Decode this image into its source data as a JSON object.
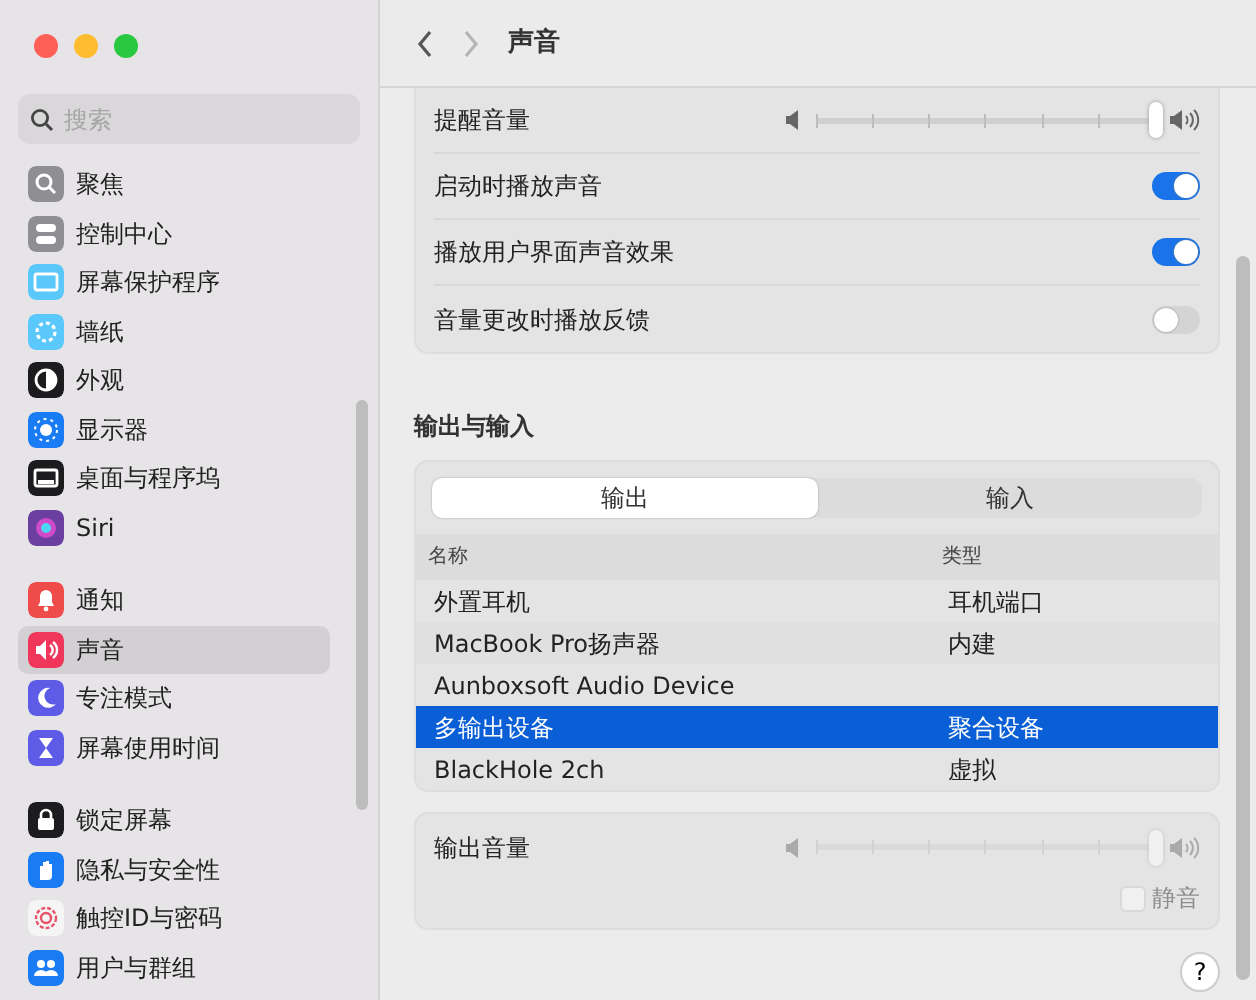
{
  "sidebar": {
    "search": {
      "placeholder": "搜索"
    },
    "groups": [
      {
        "items": [
          {
            "label": "聚焦",
            "color": "#8e8e93",
            "selected": false
          },
          {
            "label": "控制中心",
            "color": "#8e8e93",
            "selected": false
          },
          {
            "label": "屏幕保护程序",
            "color": "#5ac8fa",
            "selected": false
          },
          {
            "label": "墙纸",
            "color": "#5ac8fa",
            "selected": false
          },
          {
            "label": "外观",
            "color": "#1c1c1e",
            "selected": false
          },
          {
            "label": "显示器",
            "color": "#1a7cf5",
            "selected": false
          },
          {
            "label": "桌面与程序坞",
            "color": "#1c1c1e",
            "selected": false
          },
          {
            "label": "Siri",
            "color": "#6b3fa0",
            "selected": false
          }
        ]
      },
      {
        "items": [
          {
            "label": "通知",
            "color": "#f04b4b",
            "selected": false
          },
          {
            "label": "声音",
            "color": "#f0365a",
            "selected": true
          },
          {
            "label": "专注模式",
            "color": "#5e5ce6",
            "selected": false
          },
          {
            "label": "屏幕使用时间",
            "color": "#5e5ce6",
            "selected": false
          }
        ]
      },
      {
        "items": [
          {
            "label": "锁定屏幕",
            "color": "#1c1c1e",
            "selected": false
          },
          {
            "label": "隐私与安全性",
            "color": "#1a7cf5",
            "selected": false
          },
          {
            "label": "触控ID与密码",
            "color": "#f5f5f5",
            "selected": false
          },
          {
            "label": "用户与群组",
            "color": "#1a7cf5",
            "selected": false
          }
        ]
      }
    ]
  },
  "toolbar": {
    "title": "声音"
  },
  "settings": [
    {
      "kind": "slider",
      "label": "提醒音量",
      "level": 1.0,
      "disabled": false
    },
    {
      "kind": "toggle",
      "label": "启动时播放声音",
      "on": true
    },
    {
      "kind": "toggle",
      "label": "播放用户界面声音效果",
      "on": true
    },
    {
      "kind": "toggle",
      "label": "音量更改时播放反馈",
      "on": false
    }
  ],
  "io": {
    "heading": "输出与输入",
    "tabs": [
      {
        "label": "输出",
        "selected": true
      },
      {
        "label": "输入",
        "selected": false
      }
    ],
    "columns": [
      "名称",
      "类型"
    ],
    "rows": [
      {
        "cells": [
          "外置耳机",
          "耳机端口"
        ],
        "selected": false
      },
      {
        "cells": [
          "MacBook Pro扬声器",
          "内建"
        ],
        "selected": false
      },
      {
        "cells": [
          "Aunboxsoft Audio Device"
        ],
        "selected": false
      },
      {
        "cells": [
          "多输出设备",
          "聚合设备"
        ],
        "selected": true
      },
      {
        "cells": [
          "BlackHole 2ch",
          "虚拟"
        ],
        "selected": false
      }
    ]
  },
  "output_volume": {
    "label": "输出音量",
    "level": 1.0,
    "disabled": true,
    "mute": {
      "label": "静音",
      "checked": false,
      "disabled": true
    }
  },
  "help": {
    "label": "?"
  }
}
